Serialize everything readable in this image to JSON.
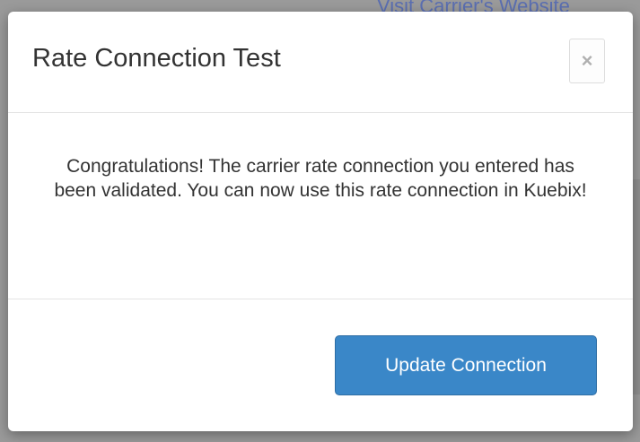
{
  "background": {
    "link_text": "Visit Carrier's Website"
  },
  "modal": {
    "title": "Rate Connection Test",
    "close_glyph": "×",
    "message": "Congratulations! The carrier rate connection you entered has been validated. You can now use this rate connection in Kuebix!",
    "primary_button_label": "Update Connection"
  },
  "colors": {
    "primary": "#3a87c8",
    "primary_border": "#2e6da4",
    "title_text": "#333333",
    "backdrop": "#7a7a7a"
  },
  "icons": {
    "close": "close-icon"
  }
}
